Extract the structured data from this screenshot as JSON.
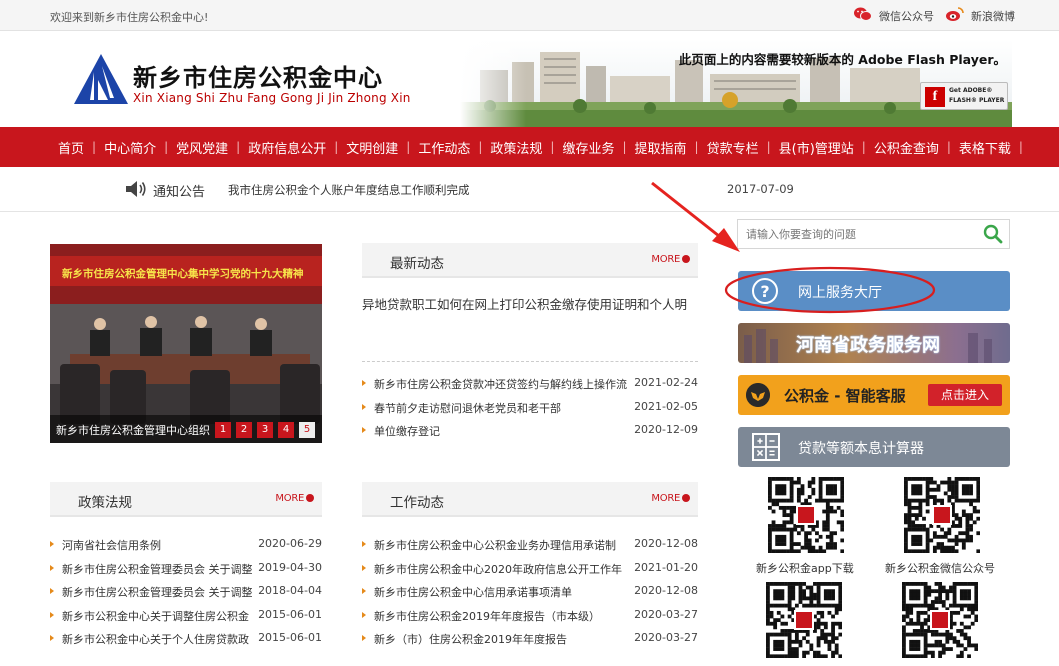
{
  "topbar": {
    "welcome": "欢迎来到新乡市住房公积金中心!",
    "wechat": "微信公众号",
    "weibo": "新浪微博"
  },
  "header": {
    "title": "新乡市住房公积金中心",
    "pinyin": "Xin Xiang Shi Zhu Fang Gong Ji Jin Zhong Xin",
    "flash_message": "此页面上的内容需要较新版本的 Adobe Flash Player。",
    "flash_button": {
      "line1": "Get ADOBE®",
      "line2": "FLASH® PLAYER",
      "logo": "f"
    }
  },
  "nav": {
    "items": [
      "首页",
      "中心简介",
      "党风党建",
      "政府信息公开",
      "文明创建",
      "工作动态",
      "政策法规",
      "缴存业务",
      "提取指南",
      "贷款专栏",
      "县(市)管理站",
      "公积金查询",
      "表格下载"
    ]
  },
  "notice": {
    "label": "通知公告",
    "text": "我市住房公积金个人账户年度结息工作顺利完成",
    "date": "2017-07-09"
  },
  "photo": {
    "banner_text": "新乡市住房公积金管理中心集中学习党的十九大精神",
    "caption": "新乡市住房公积金管理中心组织",
    "dots": [
      "1",
      "2",
      "3",
      "4",
      "5"
    ]
  },
  "news": {
    "title": "最新动态",
    "more": "MORE",
    "featured": "异地贷款职工如何在网上打印公积金缴存使用证明和个人明",
    "items": [
      {
        "text": "新乡市住房公积金贷款冲还贷签约与解约线上操作流",
        "date": "2021-02-24"
      },
      {
        "text": "春节前夕走访慰问退休老党员和老干部",
        "date": "2021-02-05"
      },
      {
        "text": "单位缴存登记",
        "date": "2020-12-09"
      }
    ]
  },
  "policy": {
    "title": "政策法规",
    "more": "MORE",
    "items": [
      {
        "text": "河南省社会信用条例",
        "date": "2020-06-29"
      },
      {
        "text": "新乡市住房公积金管理委员会 关于调整",
        "date": "2019-04-30"
      },
      {
        "text": "新乡市住房公积金管理委员会 关于调整",
        "date": "2018-04-04"
      },
      {
        "text": "新乡市公积金中心关于调整住房公积金",
        "date": "2015-06-01"
      },
      {
        "text": "新乡市公积金中心关于个人住房贷款政",
        "date": "2015-06-01"
      }
    ]
  },
  "work": {
    "title": "工作动态",
    "more": "MORE",
    "items": [
      {
        "text": "新乡市住房公积金中心公积金业务办理信用承诺制",
        "date": "2020-12-08"
      },
      {
        "text": "新乡市住房公积金中心2020年政府信息公开工作年",
        "date": "2021-01-20"
      },
      {
        "text": "新乡市住房公积金中心信用承诺事项清单",
        "date": "2020-12-08"
      },
      {
        "text": "新乡市住房公积金2019年年度报告（市本级）",
        "date": "2020-03-27"
      },
      {
        "text": "新乡（市）住房公积金2019年年度报告",
        "date": "2020-03-27"
      }
    ]
  },
  "sidebar": {
    "search_placeholder": "请输入你要查询的问题",
    "service_hall": "网上服务大厅",
    "gov_service": "河南省政务服务网",
    "ai_service": "公积金 - 智能客服",
    "ai_enter": "点击进入",
    "calculator": "贷款等额本息计算器",
    "qr_labels": [
      "新乡公积金app下载",
      "新乡公积金微信公众号"
    ]
  },
  "colors": {
    "primary_red": "#c8161d",
    "service_blue": "#5a8ec6",
    "ai_orange": "#f2a11c",
    "calc_gray": "#7d8896"
  }
}
